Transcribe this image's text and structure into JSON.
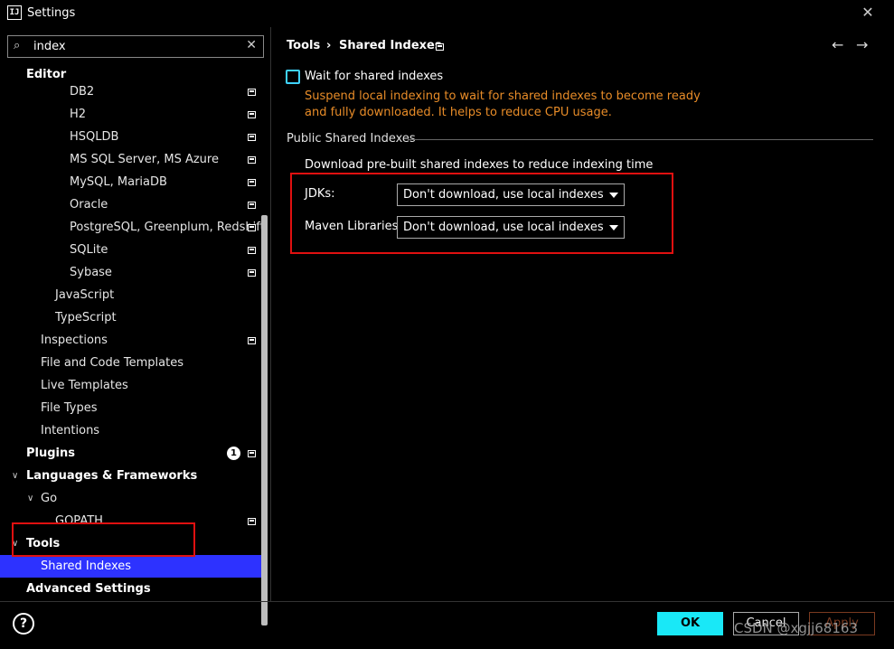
{
  "window": {
    "title": "Settings",
    "app_icon": "IJ"
  },
  "search": {
    "value": "index",
    "placeholder": ""
  },
  "sidebar": {
    "items": [
      {
        "label": "Editor"
      },
      {
        "label": "DB2"
      },
      {
        "label": "H2"
      },
      {
        "label": "HSQLDB"
      },
      {
        "label": "MS SQL Server, MS Azure"
      },
      {
        "label": "MySQL, MariaDB"
      },
      {
        "label": "Oracle"
      },
      {
        "label": "PostgreSQL, Greenplum, Redshift"
      },
      {
        "label": "SQLite"
      },
      {
        "label": "Sybase"
      },
      {
        "label": "JavaScript"
      },
      {
        "label": "TypeScript"
      },
      {
        "label": "Inspections"
      },
      {
        "label": "File and Code Templates"
      },
      {
        "label": "Live Templates"
      },
      {
        "label": "File Types"
      },
      {
        "label": "Intentions"
      },
      {
        "label": "Plugins",
        "badge": "1"
      },
      {
        "label": "Languages & Frameworks"
      },
      {
        "label": "Go"
      },
      {
        "label": "GOPATH"
      },
      {
        "label": "Tools"
      },
      {
        "label": "Shared Indexes"
      },
      {
        "label": "Advanced Settings"
      }
    ]
  },
  "breadcrumb": {
    "parent": "Tools",
    "separator": "›",
    "current": "Shared Indexes"
  },
  "content": {
    "wait_checkbox": {
      "label": "Wait for shared indexes",
      "checked": false
    },
    "warning": "Suspend local indexing to wait for shared indexes to become ready and fully downloaded. It helps to reduce CPU usage.",
    "section_title": "Public Shared Indexes",
    "section_desc": "Download pre-built shared indexes to reduce indexing time",
    "jdks": {
      "label": "JDKs:",
      "value": "Don't download, use local indexes"
    },
    "maven": {
      "label": "Maven Libraries:",
      "value": "Don't download, use local indexes"
    }
  },
  "footer": {
    "help": "?",
    "ok": "OK",
    "cancel": "Cancel",
    "apply": "Apply"
  },
  "watermark": "CSDN @xgjj68163",
  "colors": {
    "selection": "#2d32ff",
    "ok_button": "#19e8f7",
    "warning_text": "#e88c28",
    "highlight_box": "#e01010",
    "checkbox_border": "#3fd3ff"
  }
}
